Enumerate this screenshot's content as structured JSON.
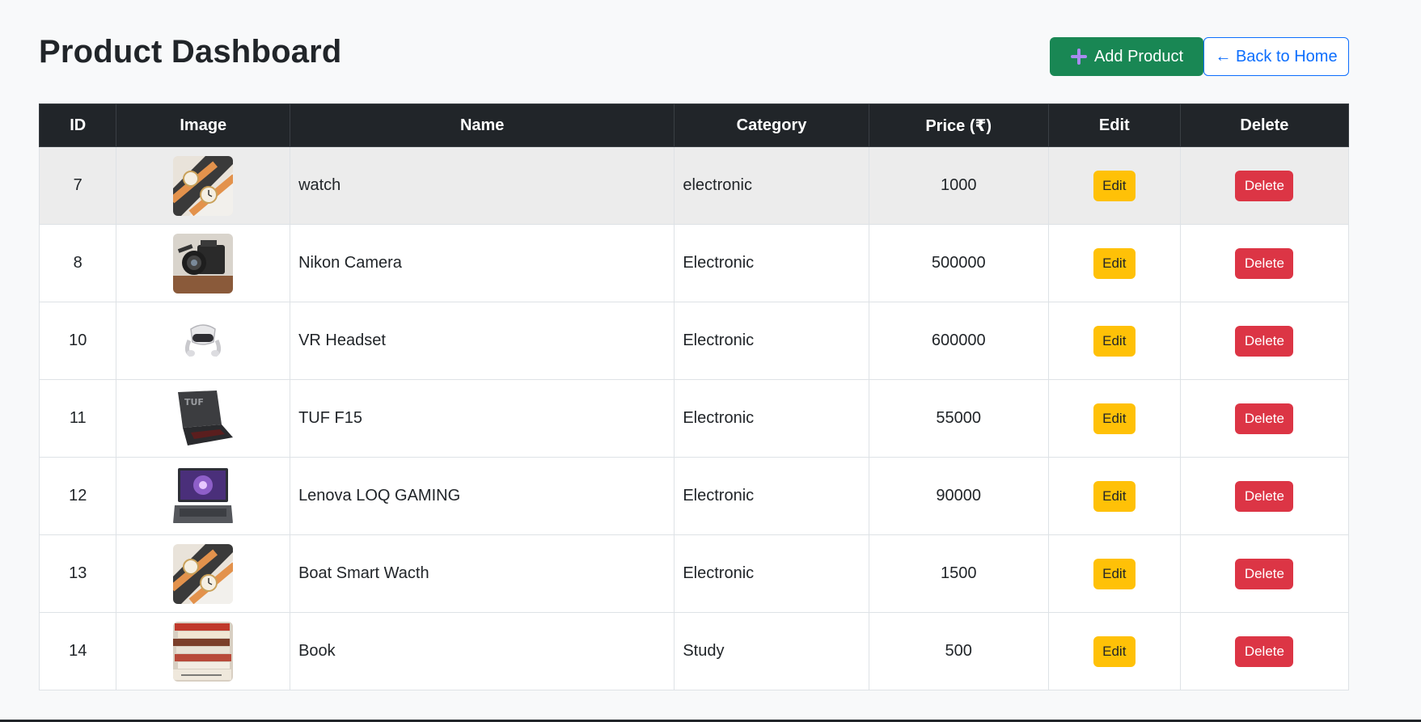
{
  "header": {
    "title": "Product Dashboard",
    "add_label": "Add Product",
    "back_label": "← Back to Home"
  },
  "table": {
    "columns": [
      "ID",
      "Image",
      "Name",
      "Category",
      "Price (₹)",
      "Edit",
      "Delete"
    ],
    "rows": [
      {
        "id": "7",
        "image": "watch-image",
        "name": "watch",
        "category": "electronic",
        "price": "1000",
        "edit": "Edit",
        "delete": "Delete"
      },
      {
        "id": "8",
        "image": "camera-image",
        "name": "Nikon Camera",
        "category": "Electronic",
        "price": "500000",
        "edit": "Edit",
        "delete": "Delete"
      },
      {
        "id": "10",
        "image": "vr-headset-image",
        "name": "VR Headset",
        "category": "Electronic",
        "price": "600000",
        "edit": "Edit",
        "delete": "Delete"
      },
      {
        "id": "11",
        "image": "laptop-image",
        "name": "TUF F15",
        "category": "Electronic",
        "price": "55000",
        "edit": "Edit",
        "delete": "Delete"
      },
      {
        "id": "12",
        "image": "laptop-image",
        "name": "Lenova LOQ GAMING",
        "category": "Electronic",
        "price": "90000",
        "edit": "Edit",
        "delete": "Delete"
      },
      {
        "id": "13",
        "image": "watch-image",
        "name": "Boat Smart Wacth",
        "category": "Electronic",
        "price": "1500",
        "edit": "Edit",
        "delete": "Delete"
      },
      {
        "id": "14",
        "image": "books-image",
        "name": "Book",
        "category": "Study",
        "price": "500",
        "edit": "Edit",
        "delete": "Delete"
      }
    ]
  },
  "colors": {
    "header_bg": "#212529",
    "add_button": "#198754",
    "back_button": "#0d6efd",
    "edit_button": "#ffc107",
    "delete_button": "#dc3545",
    "highlight_row": "#ececec"
  }
}
